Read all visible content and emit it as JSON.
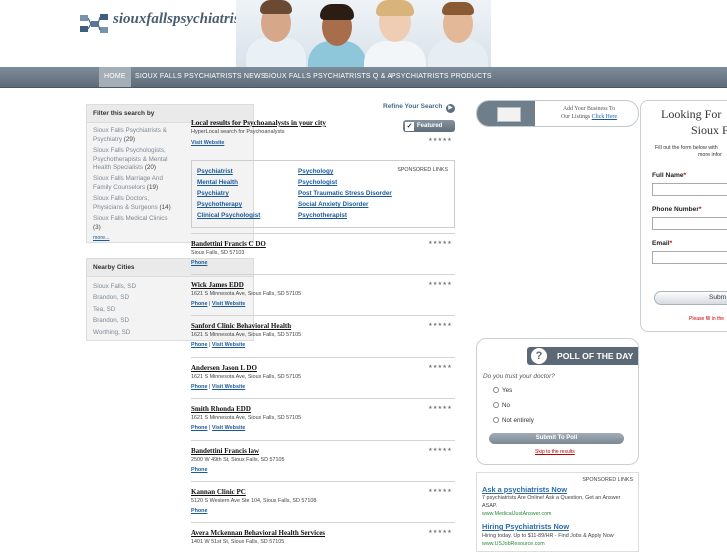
{
  "site": {
    "name": "siouxfallspsychiatrists.com",
    "accent": "#5d6c78"
  },
  "nav": {
    "items": [
      {
        "label": "HOME",
        "active": true
      },
      {
        "label": "SIOUX FALLS PSYCHIATRISTS NEWS",
        "active": false
      },
      {
        "label": "SIOUX FALLS PSYCHIATRISTS Q & A",
        "active": false
      },
      {
        "label": "PSYCHIATRISTS PRODUCTS",
        "active": false
      }
    ]
  },
  "filter": {
    "heading": "Filter this search by",
    "items": [
      {
        "line1": "Sioux Falls Psychiatrists &",
        "line2": "Psychiatry",
        "count": "(29)"
      },
      {
        "line1": "Sioux Falls Psychologists,",
        "line2": "Psychotherapists & Mental",
        "line3": "Health Specialists",
        "count": "(20)"
      },
      {
        "line1": "Sioux Falls Marriage And",
        "line2": "Family Counselors",
        "count": "(19)"
      },
      {
        "line1": "Sioux Falls Doctors,",
        "line2": "Physicians & Surgeons",
        "count": "(14)"
      },
      {
        "line1": "Sioux Falls Medical Clinics",
        "line2": "",
        "count": "(3)"
      }
    ],
    "more": "more..."
  },
  "nearby": {
    "heading": "Nearby Cities",
    "cities": [
      "Sioux Falls, SD",
      "Brandon, SD",
      "Tea, SD",
      "Brandon, SD",
      "Worthing, SD"
    ]
  },
  "refine": {
    "label": "Refine Your Search"
  },
  "featured": {
    "title": "Local results for Psychoanalysts in your city",
    "subtitle": "HyperLocal search for Psychoanalysts",
    "link": "Visit Website",
    "badge": "Featured",
    "rating": "★★★★★"
  },
  "sponsored": {
    "label": "SPONSORED LINKS",
    "links": [
      "Psychiatrist",
      "Psychology",
      "Mental Health",
      "Psychologist",
      "Psychiatry",
      "Post Traumatic Stress Disorder",
      "Psychotherapy",
      "Social Anxiety Disorder",
      "Clinical Psychologist",
      "Psychotherapist"
    ]
  },
  "listings": [
    {
      "name": "Bandettini Francis C DO",
      "address": "Sioux Falls, SD 57103",
      "links": [
        "Phone"
      ],
      "rating": "★★★★★"
    },
    {
      "name": "Wick James EDD",
      "address": "1621 S Minnesota Ave, Sioux Falls, SD 57105",
      "links": [
        "Phone",
        "Visit Website"
      ],
      "rating": "★★★★★"
    },
    {
      "name": "Sanford Clinic Behavioral Health",
      "address": "1621 S Minnesota Ave, Sioux Falls, SD 57105",
      "links": [
        "Phone",
        "Visit Website"
      ],
      "rating": "★★★★★"
    },
    {
      "name": "Andersen Jason L DO",
      "address": "1621 S Minnesota Ave, Sioux Falls, SD 57105",
      "links": [
        "Phone",
        "Visit Website"
      ],
      "rating": "★★★★★"
    },
    {
      "name": "Smith Rhonda EDD",
      "address": "1621 S Minnesota Ave, Sioux Falls, SD 57105",
      "links": [
        "Phone",
        "Visit Website"
      ],
      "rating": "★★★★★"
    },
    {
      "name": "Bandettini Francis law",
      "address": "2500 W 49th St, Sioux Falls, SD 57105",
      "links": [
        "Phone"
      ],
      "rating": "★★★★★"
    },
    {
      "name": "Kannan Clinic PC",
      "address": "5120 S Western Ave Ste 104, Sioux Falls, SD 57108",
      "links": [
        "Phone"
      ],
      "rating": "★★★★★"
    },
    {
      "name": "Avera Mckennan Behavioral Health Services",
      "address": "1401 W 51st St, Sioux Falls, SD 57105",
      "links": [],
      "rating": "★★★★★"
    }
  ],
  "promo": {
    "line1": "Add Your Business To",
    "line2": "Our Listings",
    "link": "Click Here"
  },
  "lead_form": {
    "title1": "Looking For",
    "title2": "Sioux F",
    "desc1": "Fill out the form below with",
    "desc2": "more infor",
    "full_name_label": "Full Name",
    "phone_label": "Phone Number",
    "email_label": "Email",
    "required_mark": "*",
    "submit_label": "Subm",
    "fill_note": "Please fill in the"
  },
  "poll": {
    "title": "POLL OF THE DAY",
    "question": "Do you trust your doctor?",
    "options": [
      "Yes",
      "No",
      "Not entirely"
    ],
    "submit_label": "Submit To Poll",
    "results_link": "Skip to the results"
  },
  "ads": {
    "label": "SPONSORED LINKS",
    "items": [
      {
        "title": "Ask a psychiatrists Now",
        "body": "7 psychiatrists Are Online! Ask a Question, Get an Answer ASAP.",
        "url": "www.MedicalJustAnswer.com"
      },
      {
        "title": "Hiring Psychiatrists Now",
        "body": "Hiring today. Up to $11-89/HR - Find Jobs & Apply Now",
        "url": "www.USJobResource.com"
      }
    ]
  }
}
